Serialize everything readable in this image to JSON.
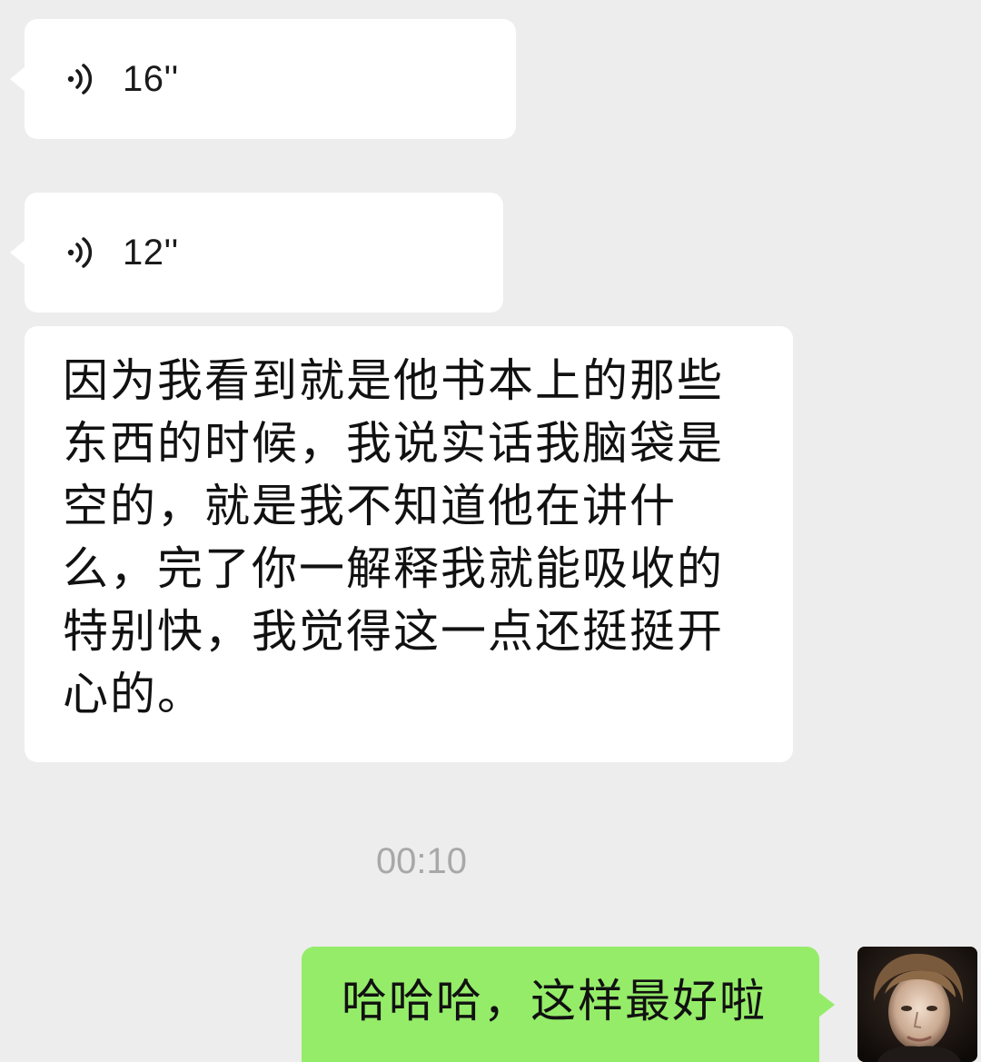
{
  "messages": {
    "voice_1": {
      "duration": "16''",
      "icon": "voice-wave-icon"
    },
    "voice_2": {
      "duration": "12''",
      "icon": "voice-wave-icon"
    },
    "text_1": "因为我看到就是他书本上的那些东西的时候，我说实话我脑袋是空的，就是我不知道他在讲什么，完了你一解释我就能吸收的特别快，我觉得这一点还挺挺开心的。",
    "timestamp": "00:10",
    "outgoing": "哈哈哈，这样最好啦"
  },
  "colors": {
    "background": "#ededed",
    "incoming_bubble": "#ffffff",
    "outgoing_bubble": "#95ec69",
    "timestamp_text": "#a8a8a8"
  }
}
